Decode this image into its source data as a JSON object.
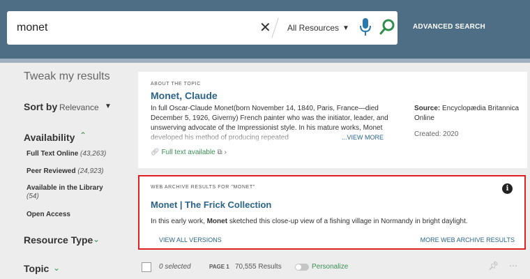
{
  "search": {
    "query": "monet",
    "scope": "All Resources",
    "advanced_label": "ADVANCED SEARCH"
  },
  "sidebar": {
    "heading": "Tweak my results",
    "sort_label": "Sort by",
    "sort_value": "Relevance",
    "availability_label": "Availability",
    "facets": [
      {
        "label": "Full Text Online",
        "count": "(43,263)"
      },
      {
        "label": "Peer Reviewed",
        "count": "(24,923)"
      },
      {
        "label": "Available in the Library",
        "count": "(54)"
      },
      {
        "label": "Open Access",
        "count": ""
      }
    ],
    "resource_type_label": "Resource Type",
    "topic_label": "Topic"
  },
  "topic_card": {
    "label": "ABOUT THE TOPIC",
    "title": "Monet, Claude",
    "description": "In full Oscar-Claude Monet(born November 14, 1840, Paris, France—died December 5, 1926, Giverny) French painter who was the initiator, leader, and unswerving advocate of the Impressionist style. In his mature works, Monet developed his method of producing repeated",
    "view_more": "...VIEW MORE",
    "full_text": "Full text available",
    "source_label": "Source:",
    "source_value": "Encyclopædia Britannica Online",
    "created": "Created: 2020"
  },
  "web_archive": {
    "label": "WEB ARCHIVE RESULTS FOR \"MONET\"",
    "title": "Monet | The Frick Collection",
    "desc_before": "In this early work, ",
    "desc_bold": "Monet",
    "desc_after": " sketched this close-up view of a fishing village in Normandy in bright daylight.",
    "view_all": "VIEW ALL VERSIONS",
    "more": "MORE WEB ARCHIVE RESULTS"
  },
  "results_bar": {
    "selected": "0 selected",
    "page": "PAGE 1",
    "results": "70,555 Results",
    "personalize": "Personalize"
  },
  "colors": {
    "header": "#4e6e86",
    "link": "#2b6488",
    "green": "#3a8f56",
    "highlight_border": "#e02020"
  }
}
